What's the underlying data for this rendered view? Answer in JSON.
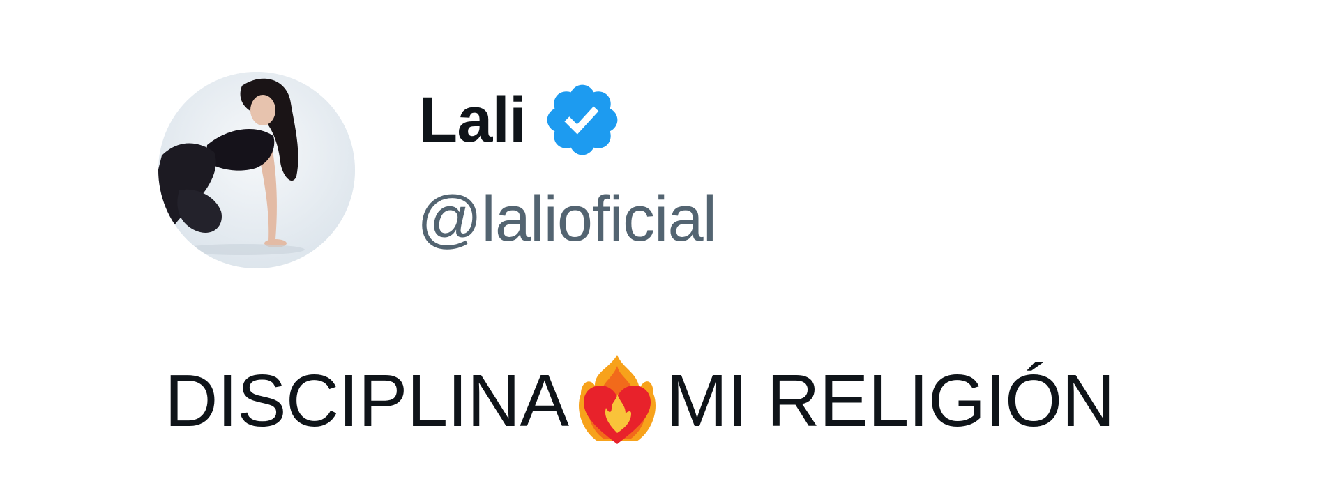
{
  "author": {
    "display_name": "Lali",
    "handle": "@lalioficial",
    "verified": true,
    "avatar_icon": "profile-photo",
    "verified_icon": "verified-badge-icon"
  },
  "tweet": {
    "text_before": "DISCIPLINA",
    "emoji": "heart-on-fire-emoji",
    "text_after": "MI RELIGIÓN"
  },
  "colors": {
    "text_primary": "#0f1419",
    "text_secondary": "#536471",
    "verified_blue": "#1d9bf0",
    "background": "#ffffff"
  }
}
